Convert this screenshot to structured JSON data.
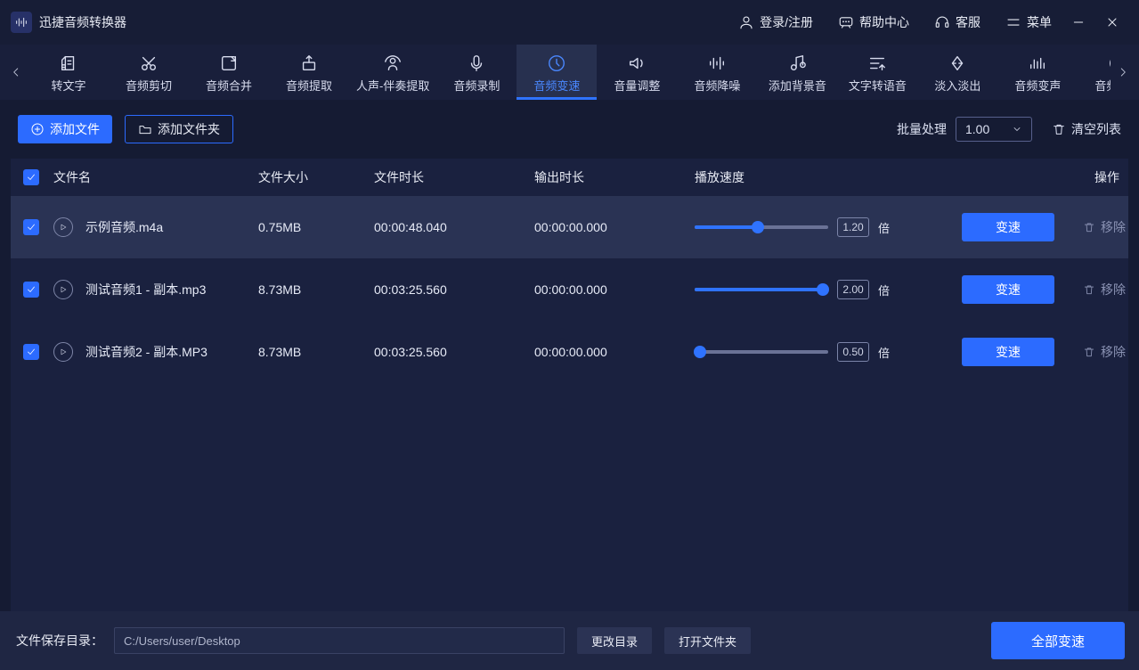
{
  "titlebar": {
    "app_name": "迅捷音频转换器",
    "login": "登录/注册",
    "help": "帮助中心",
    "service": "客服",
    "menu": "菜单"
  },
  "tabs": [
    {
      "id": "to-text",
      "label": "转文字"
    },
    {
      "id": "trim",
      "label": "音频剪切"
    },
    {
      "id": "merge",
      "label": "音频合并"
    },
    {
      "id": "extract",
      "label": "音频提取"
    },
    {
      "id": "vocal",
      "label": "人声-伴奏提取"
    },
    {
      "id": "record",
      "label": "音频录制"
    },
    {
      "id": "speed",
      "label": "音频变速"
    },
    {
      "id": "volume",
      "label": "音量调整"
    },
    {
      "id": "denoise",
      "label": "音频降噪"
    },
    {
      "id": "bgm",
      "label": "添加背景音"
    },
    {
      "id": "tts",
      "label": "文字转语音"
    },
    {
      "id": "fade",
      "label": "淡入淡出"
    },
    {
      "id": "pitch",
      "label": "音频变声"
    },
    {
      "id": "reverse",
      "label": "音频倒放"
    }
  ],
  "cmdbar": {
    "add_file": "添加文件",
    "add_folder": "添加文件夹",
    "batch_label": "批量处理",
    "batch_value": "1.00",
    "clear": "清空列表"
  },
  "columns": {
    "file_name": "文件名",
    "file_size": "文件大小",
    "file_duration": "文件时长",
    "output_duration": "输出时长",
    "speed": "播放速度",
    "ops": "操作"
  },
  "rows": [
    {
      "name": "示例音频.m4a",
      "size": "0.75MB",
      "dur": "00:00:48.040",
      "out": "00:00:00.000",
      "speed": "1.20",
      "fill": 47
    },
    {
      "name": "测试音频1 - 副本.mp3",
      "size": "8.73MB",
      "dur": "00:03:25.560",
      "out": "00:00:00.000",
      "speed": "2.00",
      "fill": 100
    },
    {
      "name": "测试音频2 - 副本.MP3",
      "size": "8.73MB",
      "dur": "00:03:25.560",
      "out": "00:00:00.000",
      "speed": "0.50",
      "fill": 0
    }
  ],
  "row_labels": {
    "unit": "倍",
    "action": "变速",
    "remove": "移除"
  },
  "footer": {
    "save_label": "文件保存目录：",
    "path": "C:/Users/user/Desktop",
    "change_dir": "更改目录",
    "open_folder": "打开文件夹",
    "run_all": "全部变速"
  }
}
